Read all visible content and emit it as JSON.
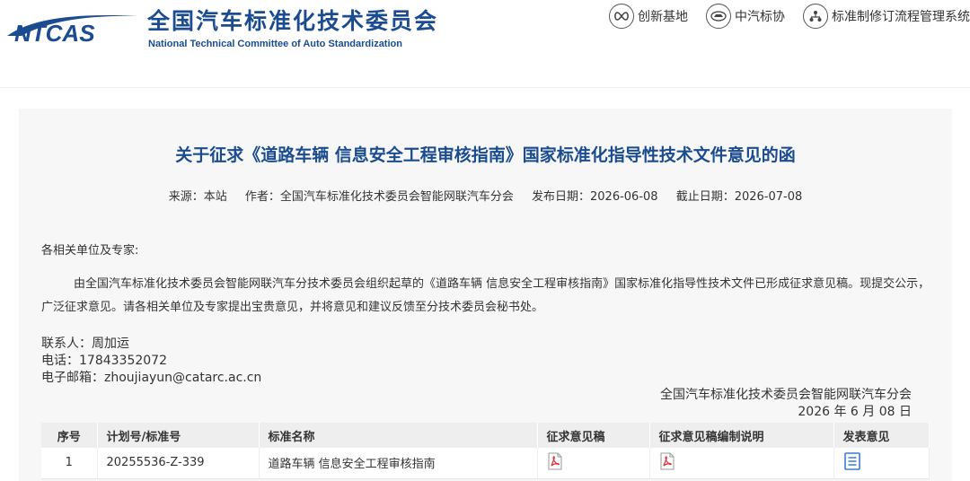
{
  "header": {
    "logo_text": "NTCAS",
    "org_name_cn": "全国汽车标准化技术委员会",
    "org_name_en": "National Technical Committee of Auto Standardization",
    "links": [
      {
        "label": "创新基地",
        "icon": "infinity-icon"
      },
      {
        "label": "中汽标协",
        "icon": "car-badge-icon"
      },
      {
        "label": "标准制修订流程管理系统",
        "icon": "org-chart-icon"
      }
    ]
  },
  "article": {
    "title": "关于征求《道路车辆 信息安全工程审核指南》国家标准化指导性技术文件意见的函",
    "meta": {
      "source": "来源：本站",
      "author": "作者：全国汽车标准化技术委员会智能网联汽车分会",
      "publish_date": "发布日期：2026-06-08",
      "deadline": "截止日期：2026-07-08"
    },
    "salutation": "各相关单位及专家:",
    "body": "由全国汽车标准化技术委员会智能网联汽车分技术委员会组织起草的《道路车辆 信息安全工程审核指南》国家标准化指导性技术文件已形成征求意见稿。现提交公示，广泛征求意见。请各相关单位及专家提出宝贵意见，并将意见和建议反馈至分技术委员会秘书处。",
    "contact": {
      "person": "联系人：周加运",
      "phone": "电话：17843352072",
      "email": "电子邮箱：zhoujiayun@catarc.ac.cn"
    },
    "signoff": {
      "org": "全国汽车标准化技术委员会智能网联汽车分会",
      "date": "2026 年 6 月 08 日"
    }
  },
  "table": {
    "headers": [
      "序号",
      "计划号/标准号",
      "标准名称",
      "征求意见稿",
      "征求意见稿编制说明",
      "发表意见"
    ],
    "rows": [
      {
        "no": "1",
        "plan_no": "20255536-Z-339",
        "name": "道路车辆 信息安全工程审核指南",
        "draft_icon": "pdf-icon",
        "explanation_icon": "pdf-icon",
        "comment_icon": "document-list-icon"
      }
    ]
  },
  "colors": {
    "brand_blue": "#1a4c8f",
    "pdf_red": "#d9363e",
    "doc_blue": "#3a7bd5"
  }
}
